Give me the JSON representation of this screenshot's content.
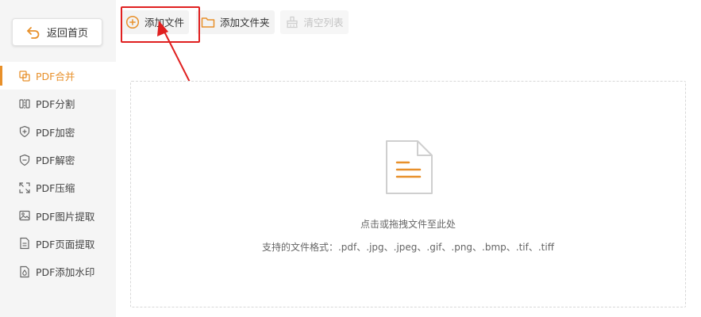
{
  "sidebar": {
    "back_label": "返回首页",
    "items": [
      {
        "label": "PDF合并",
        "icon": "merge-icon",
        "active": true
      },
      {
        "label": "PDF分割",
        "icon": "split-icon"
      },
      {
        "label": "PDF加密",
        "icon": "shield-plus-icon"
      },
      {
        "label": "PDF解密",
        "icon": "shield-minus-icon"
      },
      {
        "label": "PDF压缩",
        "icon": "compress-icon"
      },
      {
        "label": "PDF图片提取",
        "icon": "image-icon"
      },
      {
        "label": "PDF页面提取",
        "icon": "page-icon"
      },
      {
        "label": "PDF添加水印",
        "icon": "watermark-icon"
      }
    ]
  },
  "toolbar": {
    "add_file_label": "添加文件",
    "add_folder_label": "添加文件夹",
    "clear_list_label": "清空列表"
  },
  "drop_zone": {
    "hint": "点击或拖拽文件至此处",
    "formats": "支持的文件格式：.pdf、.jpg、.jpeg、.gif、.png、.bmp、.tif、.tiff"
  },
  "colors": {
    "accent": "#e8902a",
    "highlight": "#e02020"
  }
}
